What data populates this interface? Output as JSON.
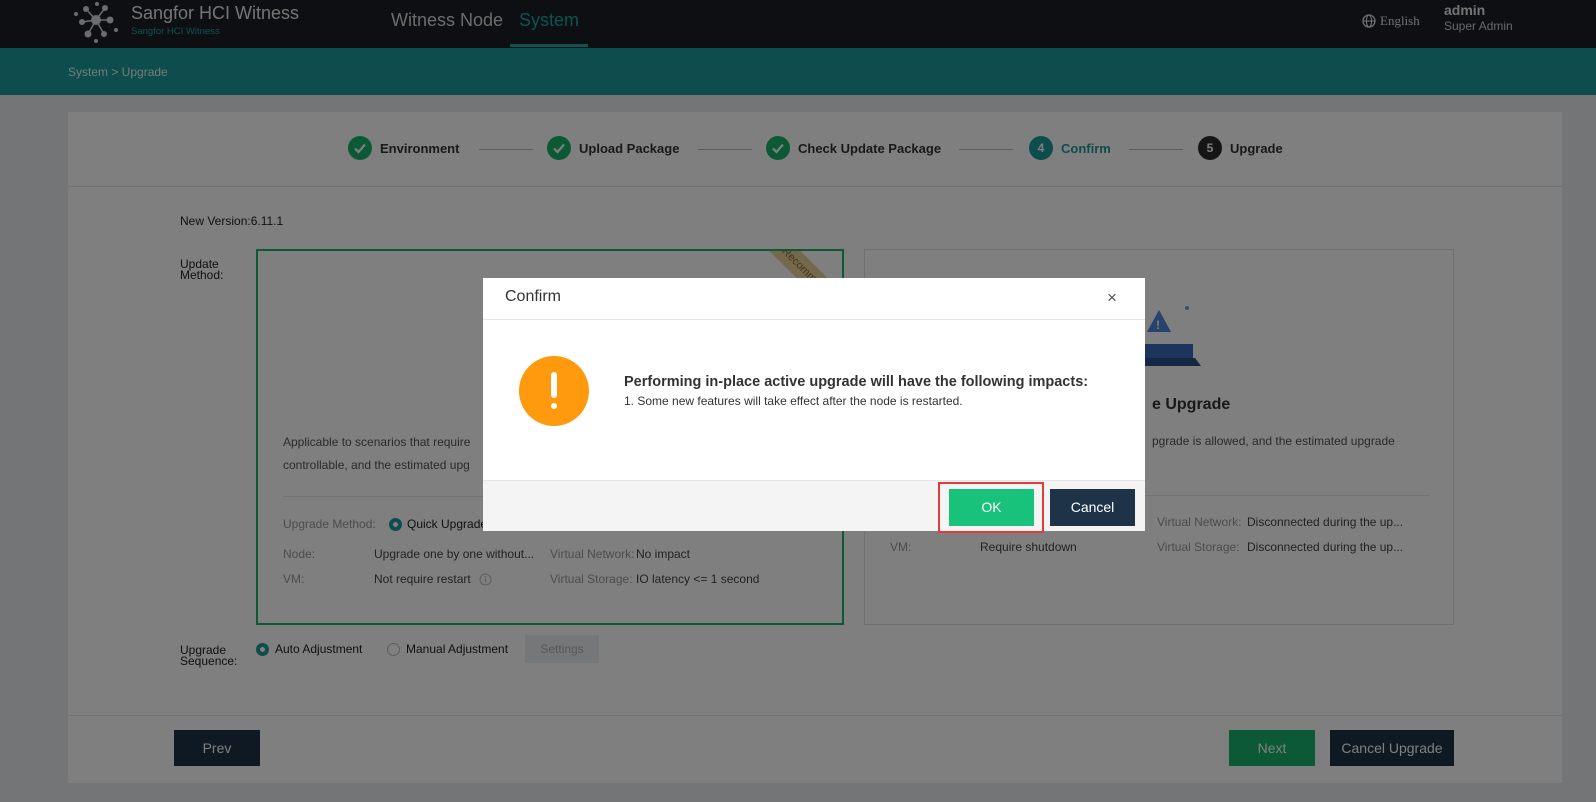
{
  "header": {
    "brand_title": "Sangfor HCI Witness",
    "brand_sub": "Sangfor HCI Witness",
    "nav": [
      "Witness Node",
      "System"
    ],
    "language": "English",
    "user_name": "admin",
    "user_role": "Super Admin"
  },
  "breadcrumb": "System  >  Upgrade",
  "steps": [
    {
      "label": "Environment",
      "state": "done"
    },
    {
      "label": "Upload Package",
      "state": "done"
    },
    {
      "label": "Check Update Package",
      "state": "done"
    },
    {
      "label": "Confirm",
      "state": "active",
      "num": "4"
    },
    {
      "label": "Upgrade",
      "state": "pending",
      "num": "5"
    }
  ],
  "version_text": "New Version:6.11.1",
  "update_method_label": "Update\nMethod:",
  "left_card": {
    "ribbon": "Recommended",
    "desc_line1": "Applicable to scenarios that require",
    "desc_line2": "controllable, and the estimated upg",
    "method_key": "Upgrade Method:",
    "method_value": "Quick Upgrade",
    "node_key": "Node:",
    "node_value": "Upgrade one by one without...",
    "vm_key": "VM:",
    "vm_value": "Not require restart",
    "vnet_key": "Virtual Network:",
    "vnet_value": "No impact",
    "vstore_key": "Virtual Storage:",
    "vstore_value": "IO latency <= 1 second"
  },
  "right_card": {
    "title_fragment": "e Upgrade",
    "desc_fragment": "pgrade is allowed, and the estimated upgrade",
    "vm_key": "VM:",
    "vm_value": "Require shutdown",
    "vnet_key": "Virtual Network:",
    "vnet_value": "Disconnected during the up...",
    "vstore_key": "Virtual Storage:",
    "vstore_value": "Disconnected during the up..."
  },
  "upgrade_sequence_label": "Upgrade\nSequence:",
  "sequence": {
    "auto": "Auto Adjustment",
    "manual": "Manual Adjustment",
    "settings": "Settings"
  },
  "footer": {
    "prev": "Prev",
    "next": "Next",
    "cancel_upgrade": "Cancel Upgrade"
  },
  "modal": {
    "title": "Confirm",
    "close": "×",
    "message": "Performing in-place active upgrade will have the following impacts:",
    "detail": "1. Some new features will take effect after the node is restarted.",
    "ok": "OK",
    "cancel": "Cancel"
  },
  "colors": {
    "teal": "#1a9a9a",
    "green": "#18b36a",
    "navy": "#1e3348",
    "warning": "#ff9a0e",
    "highlight": "#e23b3b"
  }
}
